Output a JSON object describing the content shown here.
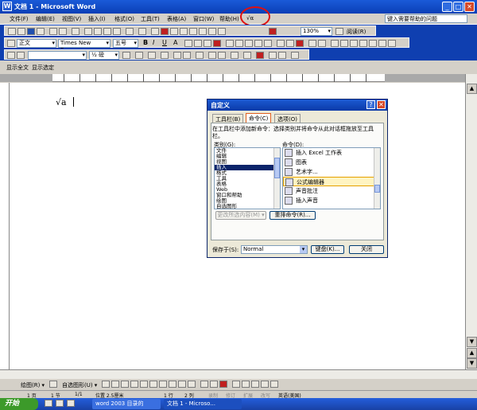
{
  "window": {
    "title": "文档 1 - Microsoft Word",
    "app_icon": "W"
  },
  "menubar": {
    "items": [
      {
        "label": "文件(F)"
      },
      {
        "label": "编辑(E)"
      },
      {
        "label": "视图(V)"
      },
      {
        "label": "插入(I)"
      },
      {
        "label": "格式(O)"
      },
      {
        "label": "工具(T)"
      },
      {
        "label": "表格(A)"
      },
      {
        "label": "窗口(W)"
      },
      {
        "label": "帮助(H)"
      },
      {
        "label": "√α"
      }
    ],
    "help_placeholder": "键入需要帮助的问题"
  },
  "toolbar1": {
    "zoom": "130%",
    "reading_mode": "阅读(R)"
  },
  "toolbar2": {
    "style": "正文",
    "font": "Times New Roman",
    "size": "五号",
    "bold": "B",
    "italic": "I",
    "underline": "U",
    "font_color_letter": "A"
  },
  "toolbar3": {
    "line_weight": "½ 磅"
  },
  "subtoolbar": {
    "show_all": "显示全文",
    "show_selected": "显示选定"
  },
  "document": {
    "equation": "√a"
  },
  "dialog": {
    "title": "自定义",
    "help": "?",
    "close": "✕",
    "tabs": [
      {
        "label": "工具栏(B)"
      },
      {
        "label": "命令(C)"
      },
      {
        "label": "选项(O)"
      }
    ],
    "hint": "在工具栏中添加新命令：选择类别并将命令从此对话框拖放至工具栏。",
    "categories_label": "类别(G):",
    "commands_label": "命令(D):",
    "categories": [
      {
        "label": "文件"
      },
      {
        "label": "编辑"
      },
      {
        "label": "视图"
      },
      {
        "label": "插入"
      },
      {
        "label": "格式"
      },
      {
        "label": "工具"
      },
      {
        "label": "表格"
      },
      {
        "label": "Web"
      },
      {
        "label": "窗口和帮助"
      },
      {
        "label": "绘图"
      },
      {
        "label": "自选图形"
      }
    ],
    "commands": [
      {
        "label": "插入 Excel 工作表"
      },
      {
        "label": "图表"
      },
      {
        "label": "艺术字..."
      },
      {
        "label": "公式编辑器"
      },
      {
        "label": "声音批注"
      },
      {
        "label": "插入声音"
      }
    ],
    "modify_selection": "更改所选内容(M) ▾",
    "rearrange": "重排命令(R)...",
    "save_in_label": "保存于(S):",
    "save_in_value": "Normal",
    "keyboard": "键盘(K)...",
    "close_btn": "关闭"
  },
  "drawbar": {
    "draw": "绘图(R) ▾",
    "autoshapes": "自选图形(U) ▾"
  },
  "statusbar": {
    "page": "1 页",
    "section": "1 节",
    "pages": "1/1",
    "position": "位置 2.5厘米",
    "line": "1 行",
    "col": "2 列",
    "rec": "录制",
    "trk": "修订",
    "ext": "扩展",
    "ovr": "改写",
    "lang": "英语(美国)"
  },
  "taskbar": {
    "start": "开始",
    "tasks": [
      {
        "label": "word 2003 目录的"
      },
      {
        "label": "文档 1 - Microso..."
      }
    ],
    "colors": {
      "start": "#3c9a2a",
      "bar": "#245edb"
    }
  },
  "colors": {
    "title_bar": "#0a3fb6",
    "highlight": "#0a246a",
    "annotation": "#e01010"
  }
}
